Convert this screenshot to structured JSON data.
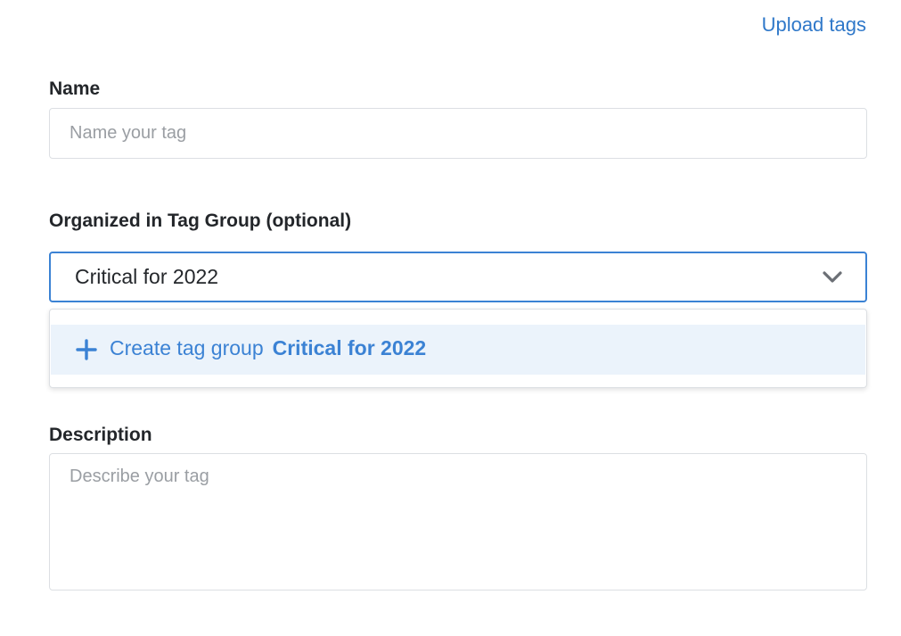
{
  "header": {
    "upload_link": "Upload tags"
  },
  "name_field": {
    "label": "Name",
    "value": "",
    "placeholder": "Name your tag"
  },
  "tag_group_field": {
    "label": "Organized in Tag Group (optional)",
    "selected_value": "Critical for 2022",
    "dropdown": {
      "create_label": "Create tag group",
      "create_value": "Critical for 2022",
      "icon": "plus-icon"
    }
  },
  "description_field": {
    "label": "Description",
    "value": "",
    "placeholder": "Describe your tag"
  },
  "colors": {
    "accent": "#3b82d4",
    "link": "#2f78c9",
    "highlight": "#ebf3fb",
    "border": "#dcdfe3"
  }
}
